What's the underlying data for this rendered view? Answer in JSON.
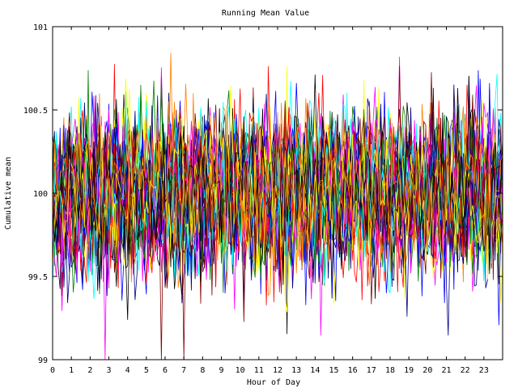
{
  "chart_data": {
    "type": "line",
    "title": "Running Mean Value",
    "xlabel": "Hour of Day",
    "ylabel": "Cumulative mean",
    "xlim": [
      0,
      24
    ],
    "ylim": [
      99,
      101
    ],
    "x_ticks": [
      "0",
      "1",
      "2",
      "3",
      "4",
      "5",
      "6",
      "7",
      "8",
      "9",
      "10",
      "11",
      "12",
      "13",
      "14",
      "15",
      "16",
      "17",
      "18",
      "19",
      "20",
      "21",
      "22",
      "23"
    ],
    "y_ticks": [
      "99",
      "99.5",
      "100",
      "100.5",
      "101"
    ],
    "grid": false,
    "legend": "none",
    "series_count": 40,
    "sample_interval_hours": 0.1,
    "value_center": 100,
    "value_spread": 0.22,
    "observed_max": 100.87,
    "observed_min": 99,
    "series_colors": [
      "#0000ff",
      "#ff0000",
      "#008000",
      "#ff00ff",
      "#00ffff",
      "#000080",
      "#800000",
      "#ffff00",
      "#000000",
      "#ff8000"
    ]
  }
}
